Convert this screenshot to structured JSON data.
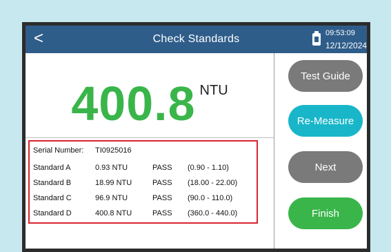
{
  "header": {
    "back_glyph": "<",
    "title": "Check Standards",
    "battery_icon": "battery-icon",
    "time": "09:53:09",
    "date": "12/12/2024"
  },
  "reading": {
    "value": "400.8",
    "unit": "NTU",
    "color": "#3ab54a"
  },
  "results": {
    "serial_label": "Serial Number:",
    "serial_value": "TI0925016",
    "rows": [
      {
        "name": "Standard A",
        "value": "0.93 NTU",
        "status": "PASS",
        "range": "(0.90 - 1.10)"
      },
      {
        "name": "Standard B",
        "value": "18.99 NTU",
        "status": "PASS",
        "range": "(18.00 - 22.00)"
      },
      {
        "name": "Standard C",
        "value": "96.9 NTU",
        "status": "PASS",
        "range": "(90.0 - 110.0)"
      },
      {
        "name": "Standard D",
        "value": "400.8 NTU",
        "status": "PASS",
        "range": "(360.0 - 440.0)"
      }
    ]
  },
  "buttons": {
    "test_guide": "Test Guide",
    "re_measure": "Re-Measure",
    "next": "Next",
    "finish": "Finish"
  },
  "colors": {
    "header_bg": "#2f5d8a",
    "accent_green": "#3ab54a",
    "accent_cyan": "#19b6c9",
    "button_gray": "#7a7a7a",
    "highlight_red": "#d9232e"
  }
}
